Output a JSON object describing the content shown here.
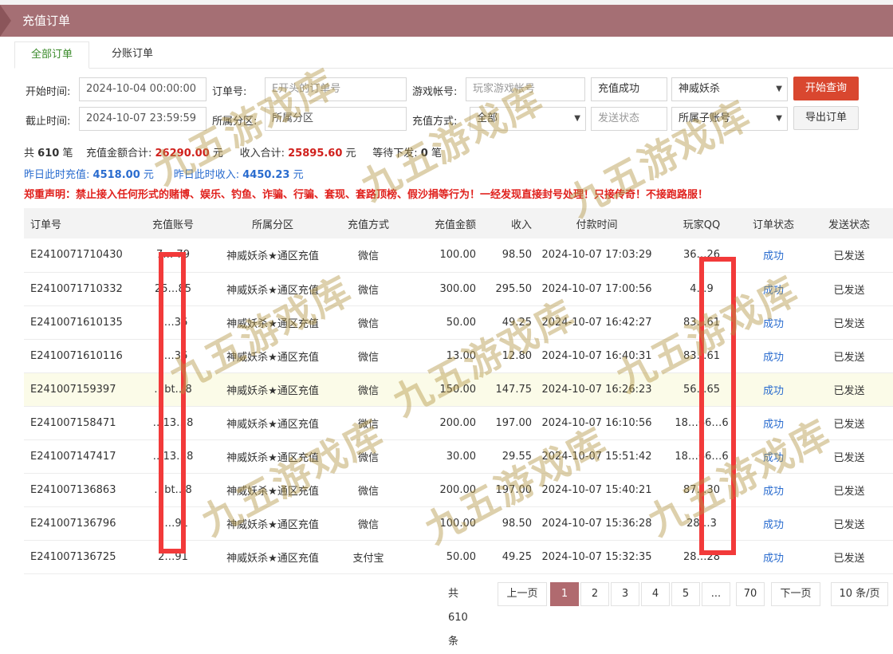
{
  "title": "充值订单",
  "tabs": [
    {
      "label": "全部订单"
    },
    {
      "label": "分账订单"
    }
  ],
  "filters": {
    "start_label": "开始时间:",
    "start_value": "2024-10-04 00:00:00",
    "end_label": "截止时间:",
    "end_value": "2024-10-07 23:59:59",
    "order_label": "订单号:",
    "order_placeholder": "E开头的订单号",
    "zone_label": "所属分区:",
    "zone_placeholder": "所属分区",
    "account_label": "游戏帐号:",
    "account_placeholder": "玩家游戏帐号",
    "method_label": "充值方式:",
    "method_value": "全部",
    "status_value": "充值成功",
    "send_status_value": "发送状态",
    "game_value": "神威妖杀",
    "sub_account_value": "所属子账号",
    "search_button": "开始查询",
    "export_button": "导出订单"
  },
  "summary": {
    "count_prefix": "共",
    "count": "610",
    "count_suffix": "笔",
    "recharge_label": "充值金额合计:",
    "recharge_value": "26290.00",
    "recharge_unit": "元",
    "income_label": "收入合计:",
    "income_value": "25895.60",
    "income_unit": "元",
    "pending_label": "等待下发:",
    "pending_value": "0",
    "pending_unit": "笔",
    "y_recharge_label": "昨日此时充值:",
    "y_recharge_value": "4518.00",
    "y_recharge_unit": "元",
    "y_income_label": "昨日此时收入:",
    "y_income_value": "4450.23",
    "y_income_unit": "元",
    "notice": "郑重声明：禁止接入任何形式的赌博、娱乐、钓鱼、诈骗、行骗、套现、套路顶榜、假沙捐等行为！一经发现直接封号处理！只接传奇！不接跑路服！"
  },
  "table": {
    "headers": [
      "订单号",
      "充值账号",
      "所属分区",
      "充值方式",
      "充值金额",
      "收入",
      "付款时间",
      "玩家QQ",
      "订单状态",
      "发送状态"
    ],
    "rows": [
      [
        "E2410071710430",
        "7… 79",
        "神威妖杀★通区充值",
        "微信",
        "100.00",
        "98.50",
        "2024-10-07 17:03:29",
        "36…26",
        "成功",
        "已发送"
      ],
      [
        "E2410071710332",
        "25…85",
        "神威妖杀★通区充值",
        "微信",
        "300.00",
        "295.50",
        "2024-10-07 17:00:56",
        "4…9",
        "成功",
        "已发送"
      ],
      [
        "E2410071610135",
        "c…36",
        "神威妖杀★通区充值",
        "微信",
        "50.00",
        "49.25",
        "2024-10-07 16:42:27",
        "83…61",
        "成功",
        "已发送"
      ],
      [
        "E2410071610116",
        "c…36",
        "神威妖杀★通区充值",
        "微信",
        "13.00",
        "12.80",
        "2024-10-07 16:40:31",
        "83…61",
        "成功",
        "已发送"
      ],
      [
        "E2410071593​97",
        "…bt…8",
        "神威妖杀★通区充值",
        "微信",
        "150.00",
        "147.75",
        "2024-10-07 16:26:23",
        "56…65",
        "成功",
        "已发送"
      ],
      [
        "E241007158471",
        "…13…8",
        "神威妖杀★通区充值",
        "微信",
        "200.00",
        "197.00",
        "2024-10-07 16:10:56",
        "18…66…6",
        "成功",
        "已发送"
      ],
      [
        "E241007147417",
        "…13…8",
        "神威妖杀★通区充值",
        "微信",
        "30.00",
        "29.55",
        "2024-10-07 15:51:42",
        "18…66…6",
        "成功",
        "已发送"
      ],
      [
        "E241007136863",
        "…bt…8",
        "神威妖杀★通区充值",
        "微信",
        "200.00",
        "197.00",
        "2024-10-07 15:40:21",
        "87…30",
        "成功",
        "已发送"
      ],
      [
        "E241007136796",
        "2…91",
        "神威妖杀★通区充值",
        "微信",
        "100.00",
        "98.50",
        "2024-10-07 15:36:28",
        "28…3",
        "成功",
        "已发送"
      ],
      [
        "E241007136725",
        "2…91",
        "神威妖杀★通区充值",
        "支付宝",
        "50.00",
        "49.25",
        "2024-10-07 15:32:35",
        "28…28",
        "成功",
        "已发送"
      ]
    ]
  },
  "pager": {
    "total": "共 610 条",
    "prev": "上一页",
    "pages": [
      "1",
      "2",
      "3",
      "4",
      "5",
      "...",
      "70"
    ],
    "next": "下一页",
    "page_size": "10 条/页"
  },
  "watermark_text": "九五游戏库",
  "colors": {
    "header": "#a56f74",
    "accent_red": "#d9472f",
    "link_blue": "#2a6ccf",
    "warning_red": "#e0201c",
    "redaction": "#f23a3a"
  }
}
